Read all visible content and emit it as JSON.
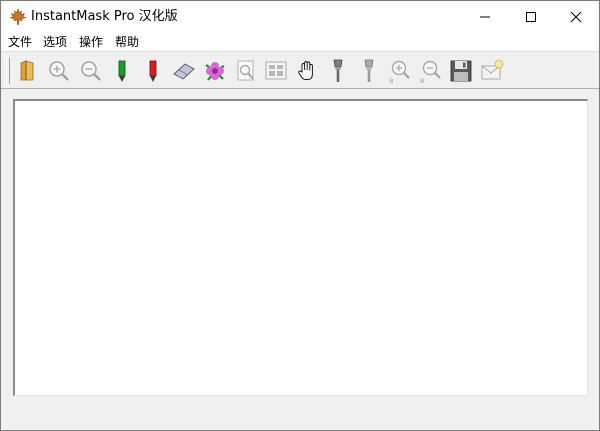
{
  "window": {
    "title": "InstantMask Pro 汉化版",
    "app_icon": "maple-leaf-icon"
  },
  "caption_buttons": [
    {
      "name": "minimize-button",
      "icon": "minimize-icon"
    },
    {
      "name": "maximize-button",
      "icon": "maximize-icon"
    },
    {
      "name": "close-button",
      "icon": "close-icon"
    }
  ],
  "menubar": {
    "file": "文件",
    "options": "选项",
    "operate": "操作",
    "help": "帮助"
  },
  "toolbar": {
    "buttons": [
      {
        "icon": "open-folder-icon",
        "enabled": true
      },
      {
        "icon": "zoom-in-icon",
        "enabled": false
      },
      {
        "icon": "zoom-out-icon",
        "enabled": false
      },
      {
        "icon": "green-pencil-icon",
        "enabled": true
      },
      {
        "icon": "red-pencil-icon",
        "enabled": true
      },
      {
        "icon": "eraser-icon",
        "enabled": true
      },
      {
        "icon": "flower-icon",
        "enabled": true
      },
      {
        "icon": "preview-icon",
        "enabled": false
      },
      {
        "icon": "grid-view-icon",
        "enabled": false
      },
      {
        "icon": "hand-pan-icon",
        "enabled": true
      },
      {
        "icon": "brush-icon",
        "enabled": true
      },
      {
        "icon": "brush-alt-icon",
        "enabled": false
      },
      {
        "icon": "zoom-in-b-icon",
        "enabled": false
      },
      {
        "icon": "zoom-out-b-icon",
        "enabled": false
      },
      {
        "icon": "save-icon",
        "enabled": true
      },
      {
        "icon": "export-icon",
        "enabled": false
      }
    ],
    "subscript_b": "B"
  },
  "colors": {
    "title_bar": "#ffffff",
    "chrome": "#f0f0f0",
    "canvas": "#ffffff",
    "disabled_icon": "#9a9a9a"
  }
}
